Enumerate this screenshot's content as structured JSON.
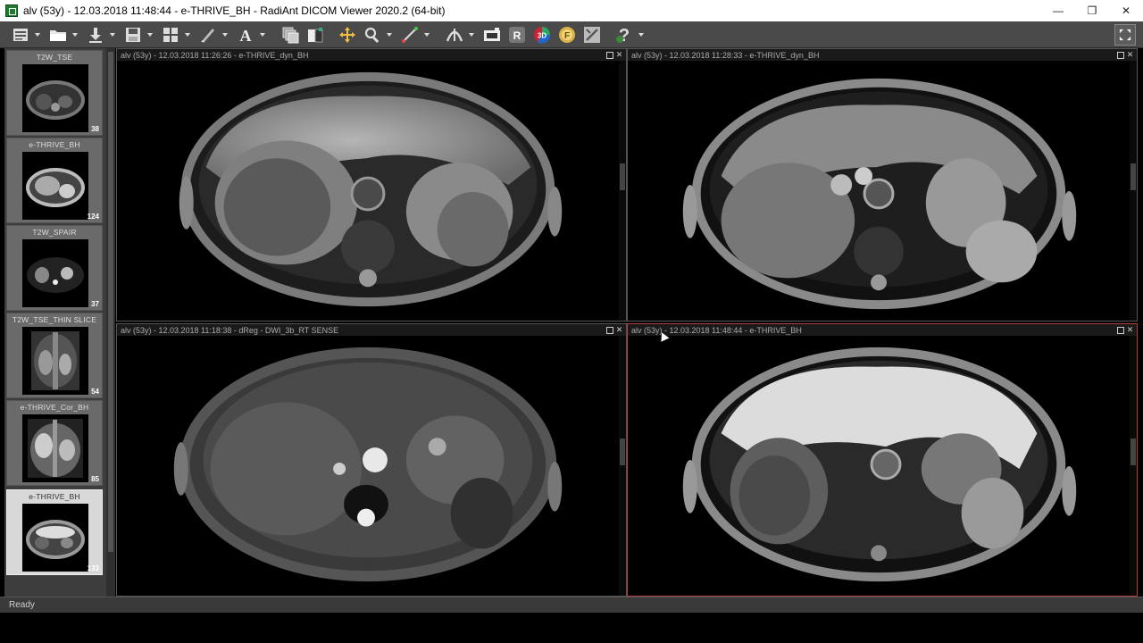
{
  "window": {
    "title": "alv (53y) - 12.03.2018 11:48:44 - e-THRIVE_BH - RadiAnt DICOM Viewer 2020.2 (64-bit)",
    "minimize_icon": "minimize-icon",
    "maximize_icon": "maximize-icon",
    "close_icon": "close-icon"
  },
  "toolbar": {
    "tools": [
      "menu",
      "open-folder",
      "download",
      "save",
      "layout",
      "annotate",
      "text",
      "series-stack",
      "window-level",
      "pan",
      "zoom",
      "measure",
      "3d-cursor",
      "screenshot",
      "mpr",
      "3d",
      "fusion",
      "settings",
      "help"
    ]
  },
  "series": [
    {
      "label": "T2W_TSE",
      "count": "38",
      "active": false
    },
    {
      "label": "e-THRIVE_BH",
      "count": "124",
      "active": false
    },
    {
      "label": "T2W_SPAIR",
      "count": "37",
      "active": false
    },
    {
      "label": "T2W_TSE_THIN SLICE",
      "count": "54",
      "active": false
    },
    {
      "label": "e-THRIVE_Cor_BH",
      "count": "85",
      "active": false
    },
    {
      "label": "e-THRIVE_BH",
      "count": "133",
      "active": true
    }
  ],
  "viewports": [
    {
      "header": "alv (53y) - 12.03.2018 11:26:26 - e-THRIVE_dyn_BH"
    },
    {
      "header": "alv (53y) - 12.03.2018 11:28:33 - e-THRIVE_dyn_BH"
    },
    {
      "header": "alv (53y) - 12.03.2018 11:18:38 - dReg - DWI_3b_RT SENSE"
    },
    {
      "header": "alv (53y) - 12.03.2018 11:48:44 - e-THRIVE_BH"
    }
  ],
  "status": {
    "text": "Ready"
  }
}
